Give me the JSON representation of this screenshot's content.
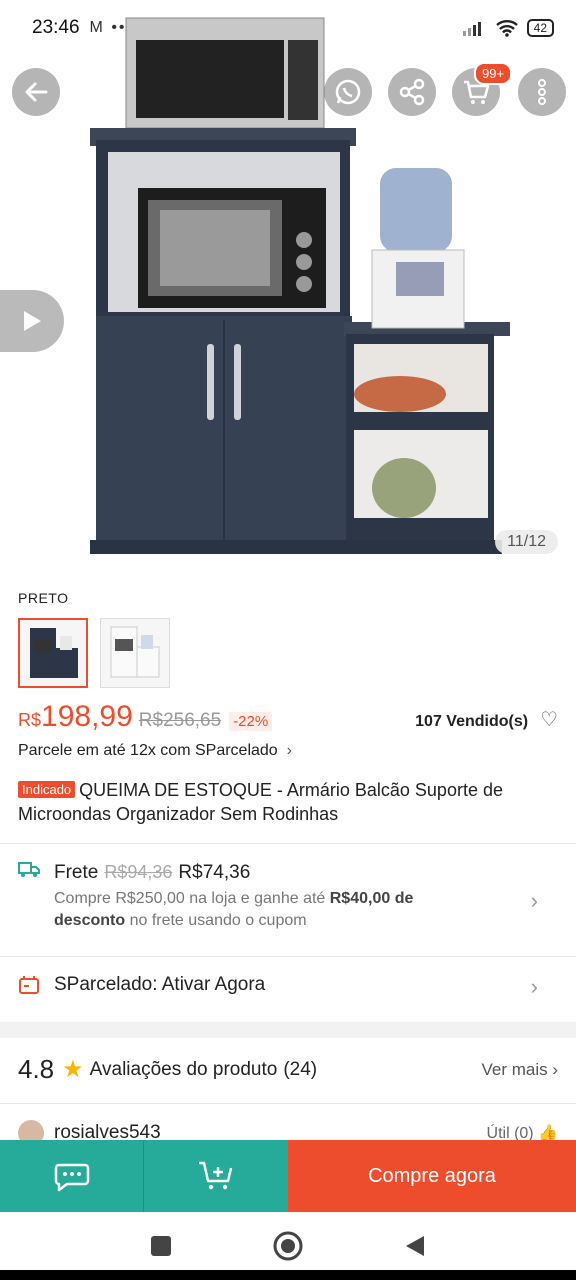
{
  "status_bar": {
    "time": "23:46",
    "left_icons": "M ••",
    "battery": "42"
  },
  "hero": {
    "image_counter": "11/12",
    "cart_badge": "99+"
  },
  "variant": {
    "label": "PRETO"
  },
  "price": {
    "currency": "R$",
    "current": "198,99",
    "original": "R$256,65",
    "discount": "-22%",
    "sold": "107 Vendido(s)",
    "installment": "Parcele em até 12x com SParcelado"
  },
  "product": {
    "tag": "Indicado",
    "title": "QUEIMA DE ESTOQUE - Armário Balcão Suporte de Microondas Organizador Sem Rodinhas"
  },
  "shipping": {
    "label": "Frete",
    "old_price": "R$94,36",
    "new_price": "R$74,36",
    "desc_prefix": "Compre R$250,00 na loja e ganhe até ",
    "desc_bold": "R$40,00 de desconto",
    "desc_suffix": " no frete usando o cupom"
  },
  "sparcelado": {
    "label": "SParcelado: Ativar Agora"
  },
  "ratings": {
    "score": "4.8",
    "label": "Avaliações do produto",
    "count": "(24)",
    "see_more": "Ver mais"
  },
  "review": {
    "username": "rosialves543",
    "useful": "Útil (0)"
  },
  "actions": {
    "buy_now": "Compre agora"
  },
  "colors": {
    "brand": "#ee4d2d",
    "teal": "#26aa99"
  }
}
